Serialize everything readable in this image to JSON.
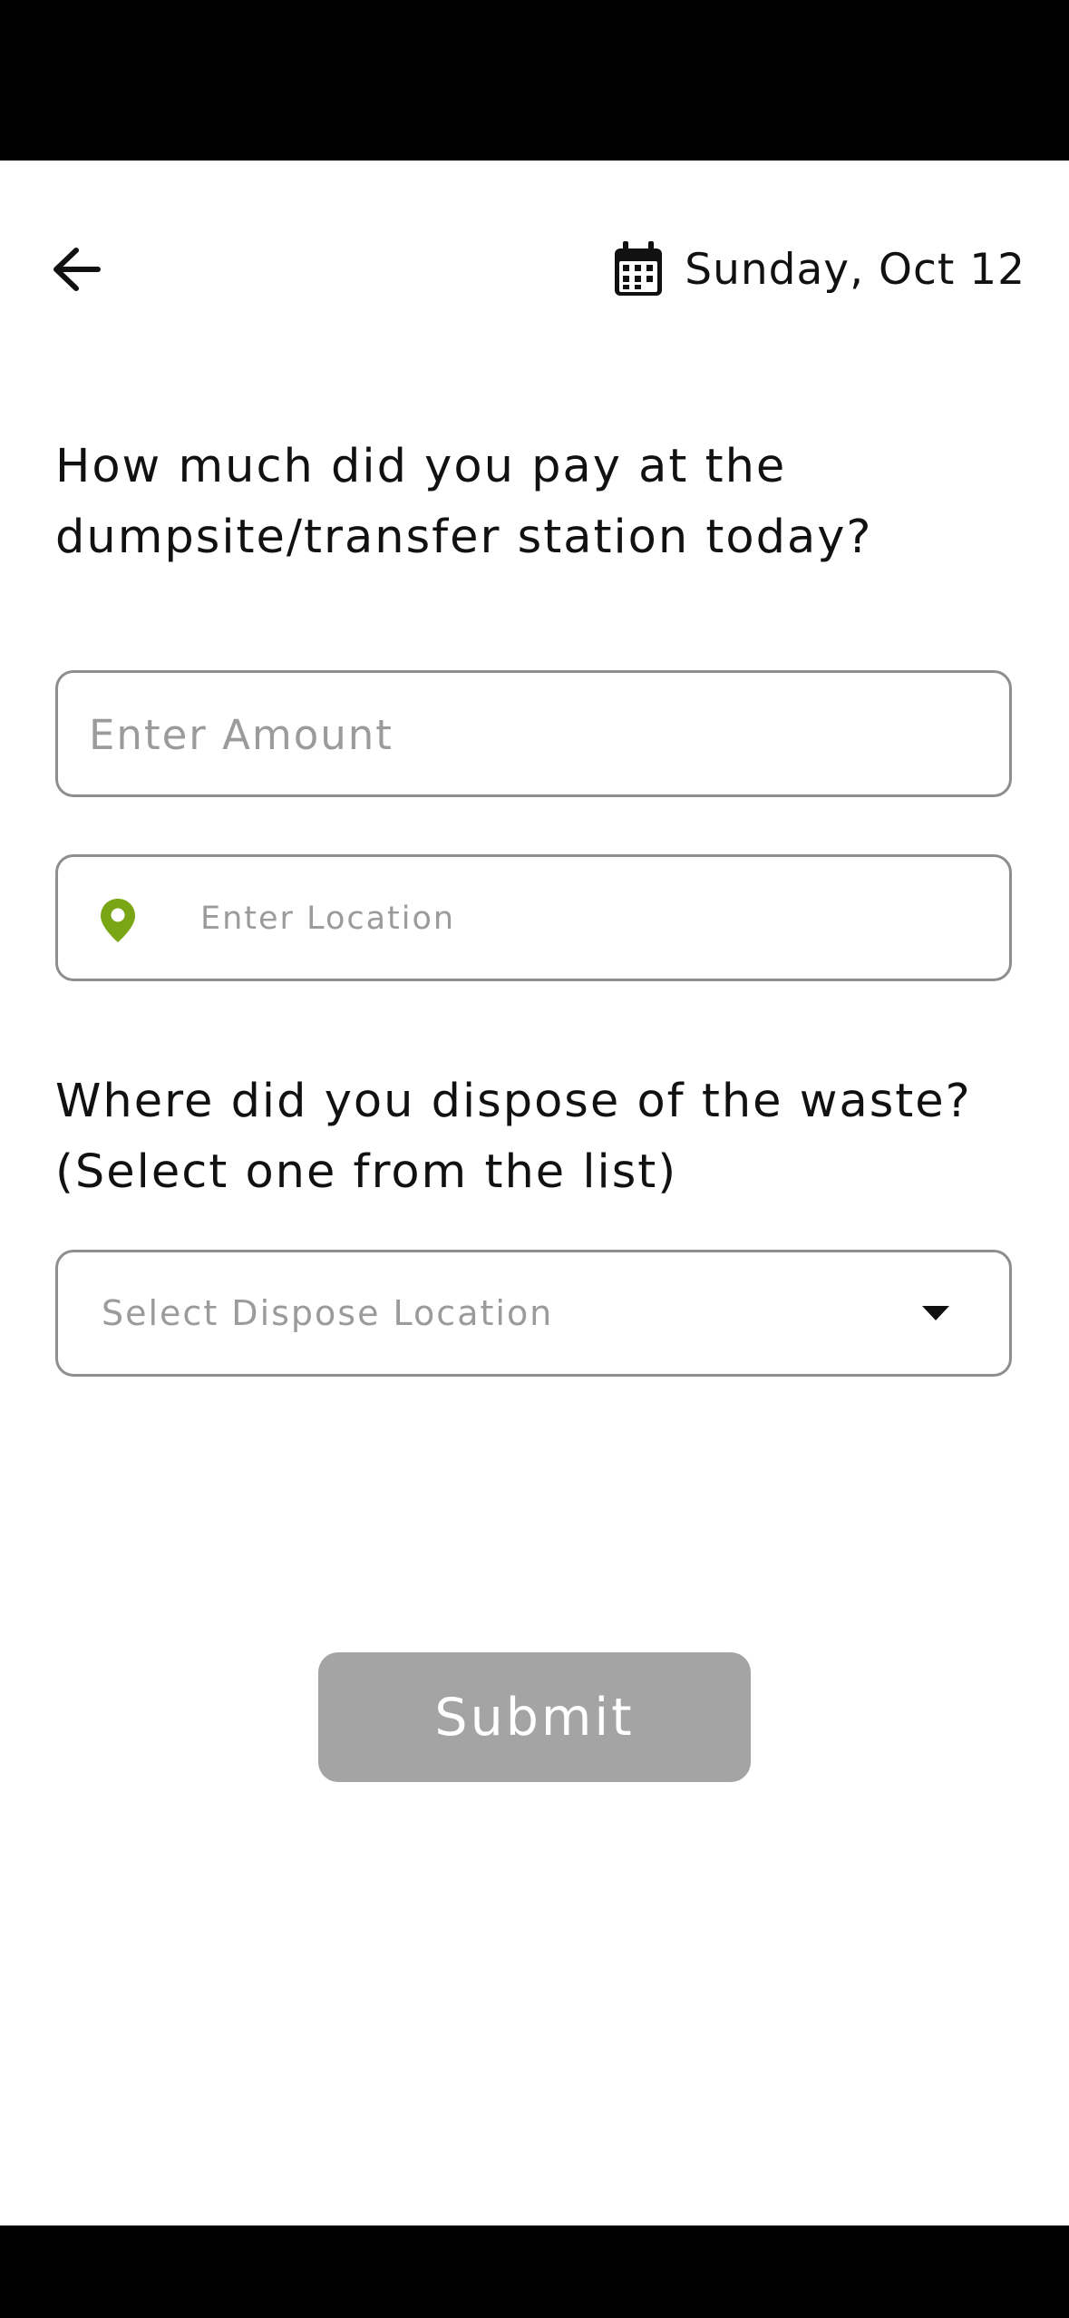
{
  "header": {
    "back_icon": "arrow-left-icon",
    "calendar_icon": "calendar-icon",
    "date": "Sunday, Oct 12"
  },
  "form": {
    "question_payment": "How much did you pay at the dumpsite/transfer station today?",
    "amount": {
      "value": "",
      "placeholder": "Enter Amount"
    },
    "location": {
      "icon": "location-pin-icon",
      "icon_color": "#7aa514",
      "value": "",
      "placeholder": "Enter Location"
    },
    "question_dispose": "Where did you dispose of the waste? (Select one from the list)",
    "dispose_select": {
      "placeholder": "Select Dispose Location",
      "icon": "chevron-down-icon"
    },
    "submit_label": "Submit"
  },
  "colors": {
    "accent_green": "#7aa514",
    "submit_disabled": "#a4a4a4",
    "field_border": "#8e8e8e",
    "placeholder_text": "#9b9b9b"
  }
}
